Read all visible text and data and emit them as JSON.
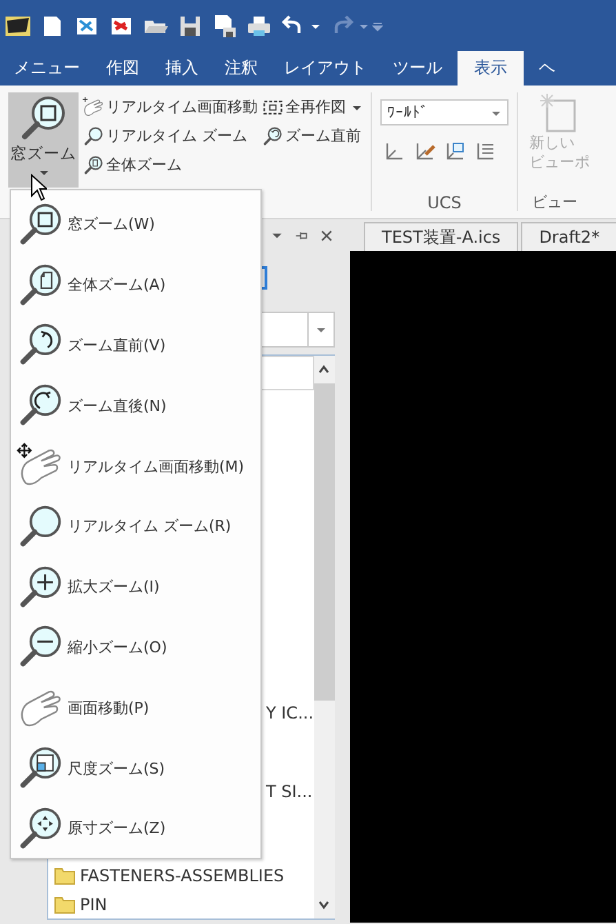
{
  "ribbon_tabs": [
    {
      "label": "メニュー",
      "selected": false
    },
    {
      "label": "作図",
      "selected": false
    },
    {
      "label": "挿入",
      "selected": false
    },
    {
      "label": "注釈",
      "selected": false
    },
    {
      "label": "レイアウト",
      "selected": false
    },
    {
      "label": "ツール",
      "selected": false
    },
    {
      "label": "表示",
      "selected": true
    },
    {
      "label": "ヘ",
      "selected": false
    }
  ],
  "ribbon": {
    "large_button": {
      "label": "窓ズーム",
      "pressed": true
    },
    "small_buttons": [
      {
        "label": "リアルタイム画面移動",
        "kind": "realtime-pan"
      },
      {
        "label": "リアルタイム ズーム",
        "kind": "realtime-zoom"
      },
      {
        "label": "全体ズーム",
        "kind": "all"
      }
    ],
    "small_buttons_2": [
      {
        "label": "全再作図",
        "kind": "redraw",
        "dropdown": true
      },
      {
        "label": "ズーム直前",
        "kind": "previous",
        "dropdown": false
      }
    ],
    "ucs": {
      "combo_value": "ﾜｰﾙﾄﾞ",
      "label": "UCS"
    },
    "viewport": {
      "button_lines": [
        "新しい",
        "ビューポ"
      ],
      "disabled": true,
      "label": "ビュー"
    }
  },
  "panel": {
    "list_rows": [
      {
        "text": "Y IC...",
        "kind": "text"
      },
      {
        "text": "T SI...",
        "kind": "text"
      },
      {
        "text": "FASTENERS-ASSEMBLIES",
        "kind": "folder"
      },
      {
        "text": "PIN",
        "kind": "folder"
      }
    ]
  },
  "doc_tabs": [
    {
      "label": "TEST装置-A.ics"
    },
    {
      "label": "Draft2*"
    }
  ],
  "menu": {
    "items": [
      {
        "label": "窓ズーム(W)",
        "kind": "window"
      },
      {
        "label": "全体ズーム(A)",
        "kind": "all"
      },
      {
        "label": "ズーム直前(V)",
        "kind": "previous"
      },
      {
        "label": "ズーム直後(N)",
        "kind": "next"
      },
      {
        "label": "リアルタイム画面移動(M)",
        "kind": "realtime-pan"
      },
      {
        "label": "リアルタイム ズーム(R)",
        "kind": "realtime-zoom"
      },
      {
        "label": "拡大ズーム(I)",
        "kind": "zoom-in"
      },
      {
        "label": "縮小ズーム(O)",
        "kind": "zoom-out"
      },
      {
        "label": "画面移動(P)",
        "kind": "pan"
      },
      {
        "label": "尺度ズーム(S)",
        "kind": "scale"
      },
      {
        "label": "原寸ズーム(Z)",
        "kind": "actual"
      }
    ]
  }
}
